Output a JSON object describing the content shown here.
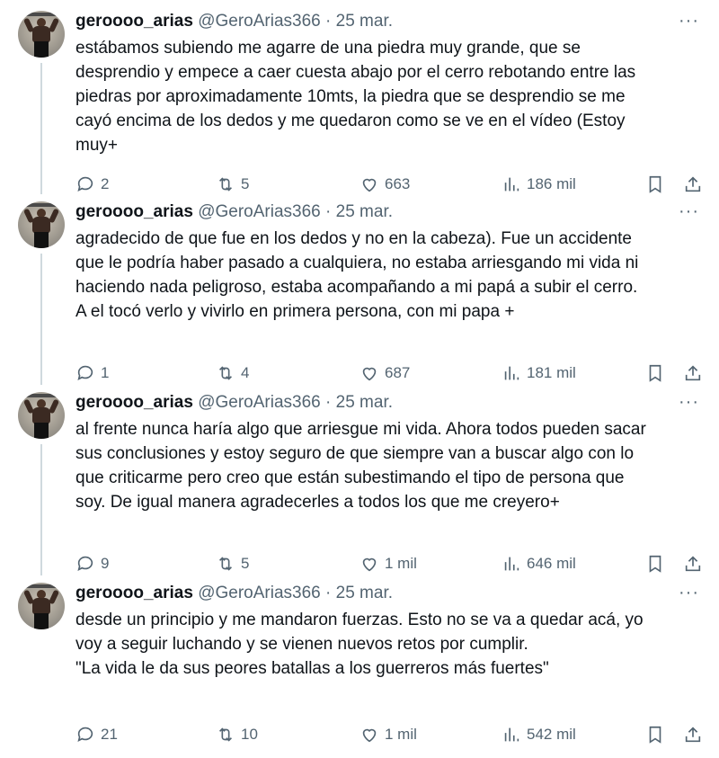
{
  "tweets": [
    {
      "name": "geroooo_arias",
      "handle": "@GeroArias366",
      "separator": "·",
      "date": "25 mar.",
      "text": "estábamos subiendo me agarre de una piedra muy grande, que se\ndesprendio y empece a caer cuesta abajo por el cerro rebotando entre las\npiedras por aproximadamente 10mts, la piedra que se desprendio se me\ncayó encima de los dedos y me quedaron como se ve en el vídeo (Estoy\nmuy+",
      "replies": "2",
      "retweets": "5",
      "likes": "663",
      "views": "186 mil"
    },
    {
      "name": "geroooo_arias",
      "handle": "@GeroArias366",
      "separator": "·",
      "date": "25 mar.",
      "text": "agradecido de que fue en los dedos y no en la cabeza). Fue un accidente\nque le podría haber pasado a cualquiera, no estaba arriesgando mi vida ni\nhaciendo nada peligroso, estaba acompañando a mi papá a subir el cerro.\nA el tocó verlo y vivirlo en primera persona,  con mi papa +",
      "replies": "1",
      "retweets": "4",
      "likes": "687",
      "views": "181 mil"
    },
    {
      "name": "geroooo_arias",
      "handle": "@GeroArias366",
      "separator": "·",
      "date": "25 mar.",
      "text": "al frente nunca haría algo que arriesgue mi vida. Ahora todos pueden sacar\nsus conclusiones y estoy seguro de que siempre van a buscar algo con lo\nque criticarme pero creo que están subestimando el tipo de persona que\nsoy. De igual manera agradecerles a todos los que me creyero+",
      "replies": "9",
      "retweets": "5",
      "likes": "1 mil",
      "views": "646 mil"
    },
    {
      "name": "geroooo_arias",
      "handle": "@GeroArias366",
      "separator": "·",
      "date": "25 mar.",
      "text": "desde un principio y me mandaron fuerzas. Esto no se va a quedar acá, yo\nvoy a seguir luchando y se vienen nuevos retos por cumplir.\n\"La vida le da sus peores batallas a los guerreros más fuertes\"",
      "replies": "21",
      "retweets": "10",
      "likes": "1 mil",
      "views": "542 mil"
    }
  ],
  "icons": {
    "reply": "reply-icon",
    "retweet": "retweet-icon",
    "like": "heart-icon",
    "views": "views-icon",
    "bookmark": "bookmark-icon",
    "share": "share-icon",
    "more": "more-icon"
  },
  "more_glyph": "···",
  "colors": {
    "text": "#0f1419",
    "secondary": "#536471",
    "thread_line": "#cfd9de",
    "background": "#ffffff"
  }
}
